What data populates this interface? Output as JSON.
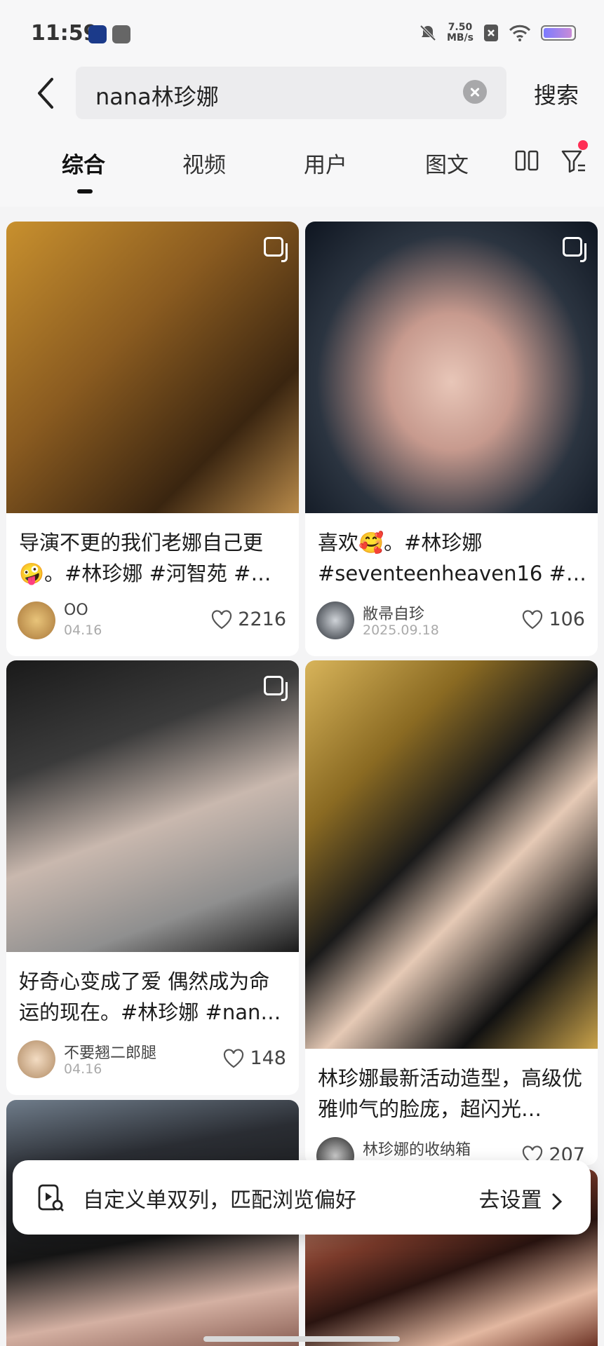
{
  "status_bar": {
    "time": "11:59",
    "net_speed_value": "7.50",
    "net_speed_unit": "MB/s"
  },
  "search": {
    "query": "nana林珍娜",
    "button_label": "搜索"
  },
  "tabs": [
    {
      "label": "综合",
      "active": true
    },
    {
      "label": "视频",
      "active": false
    },
    {
      "label": "用户",
      "active": false
    },
    {
      "label": "图文",
      "active": false
    }
  ],
  "cards": [
    {
      "title": "导演不更的我们老娜自己更🤪。#林珍娜 #河智苑 #…",
      "author": "OO",
      "date": "04.16",
      "likes": "2216"
    },
    {
      "title": "喜欢🥰。#林珍娜 #seventeenheaven16 #…",
      "author": "敝帚自珍",
      "date": "2025.09.18",
      "likes": "106"
    },
    {
      "title": "好奇心变成了爱 偶然成为命运的现在。#林珍娜 #nan…",
      "author": "不要翘二郎腿",
      "date": "04.16",
      "likes": "148"
    },
    {
      "title": "林珍娜最新活动造型，高级优雅帅气的脸庞，超闪光…",
      "author": "林珍娜的收纳箱",
      "date": "",
      "likes": "207"
    }
  ],
  "banner": {
    "text": "自定义单双列，匹配浏览偏好",
    "action": "去设置"
  },
  "icons": {
    "back": "chevron-left-icon",
    "clear": "clear-icon",
    "layout": "dual-column-icon",
    "filter": "filter-icon",
    "image_badge": "multi-image-icon",
    "like": "heart-icon",
    "banner": "browse-preference-icon",
    "chevron": "chevron-right-icon"
  },
  "colors": {
    "accent_dot": "#ff2f55",
    "text": "#222222",
    "background": "#f4f4f5"
  }
}
